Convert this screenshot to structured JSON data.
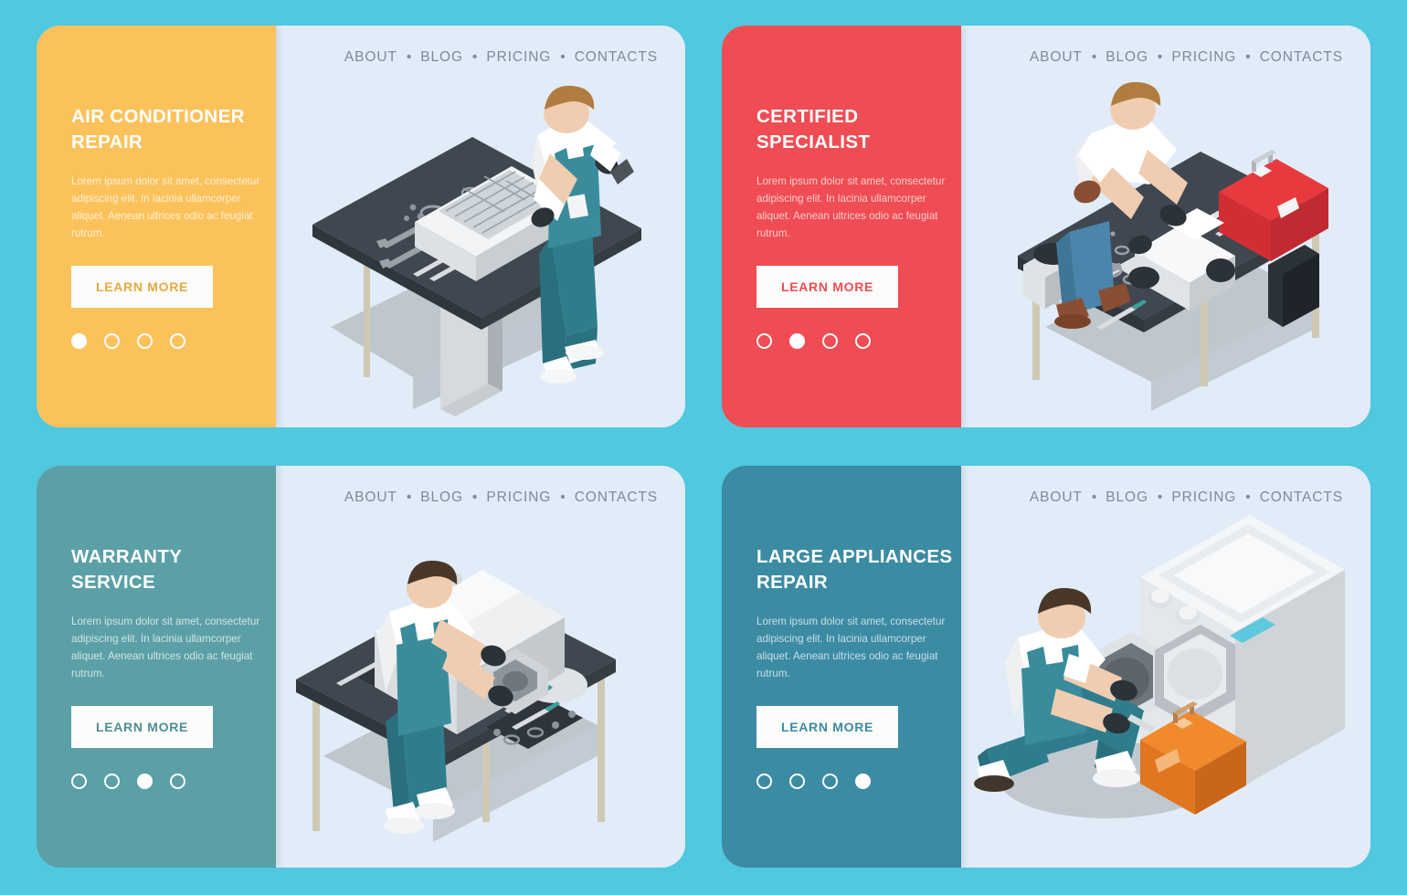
{
  "page": {
    "background_color": "#4fc8e0",
    "stage_color": "#e1ecf8"
  },
  "nav": {
    "items": [
      "ABOUT",
      "BLOG",
      "PRICING",
      "CONTACTS"
    ],
    "separator": "•"
  },
  "common": {
    "button_label": "LEARN MORE",
    "body_text": "Lorem ipsum dolor sit amet, consectetur adipiscing elit. In lacinia ullamcorper aliquet. Aenean ultrices odio ac feugiat rutrum.",
    "dot_count": 4
  },
  "cards": [
    {
      "id": "air-conditioner-repair",
      "title": "AIR CONDITIONER REPAIR",
      "panel_color": "#fbc25c",
      "button_label": "LEARN MORE",
      "button_text_color": "#e6a93f",
      "active_dot": 1,
      "body_text": "Lorem ipsum dolor sit amet, consectetur adipiscing elit. In lacinia ullamcorper aliquet. Aenean ultrices odio ac feugiat rutrum.",
      "illustration": "technician-repairing-wall-air-conditioner-on-workbench"
    },
    {
      "id": "certified-specialist",
      "title": "CERTIFIED SPECIALIST",
      "panel_color": "#ef4c53",
      "button_label": "LEARN MORE",
      "button_text_color": "#ef4c53",
      "active_dot": 2,
      "body_text": "Lorem ipsum dolor sit amet, consectetur adipiscing elit. In lacinia ullamcorper aliquet. Aenean ultrices odio ac feugiat rutrum.",
      "illustration": "specialist-servicing-appliance-motor-with-red-toolbox"
    },
    {
      "id": "warranty-service",
      "title": "WARRANTY SERVICE",
      "panel_color": "#5ba0a6",
      "button_label": "LEARN MORE",
      "button_text_color": "#4c8e95",
      "active_dot": 3,
      "body_text": "Lorem ipsum dolor sit amet, consectetur adipiscing elit. In lacinia ullamcorper aliquet. Aenean ultrices odio ac feugiat rutrum.",
      "illustration": "worker-servicing-large-white-machine-on-bench"
    },
    {
      "id": "large-appliances-repair",
      "title": "LARGE APPLIANCES REPAIR",
      "panel_color": "#3b8ba3",
      "button_label": "LEARN MORE",
      "button_text_color": "#3b8ba3",
      "active_dot": 4,
      "body_text": "Lorem ipsum dolor sit amet, consectetur adipiscing elit. In lacinia ullamcorper aliquet. Aenean ultrices odio ac feugiat rutrum.",
      "illustration": "kneeling-repairman-fixing-washing-machine-with-orange-toolbox"
    }
  ]
}
